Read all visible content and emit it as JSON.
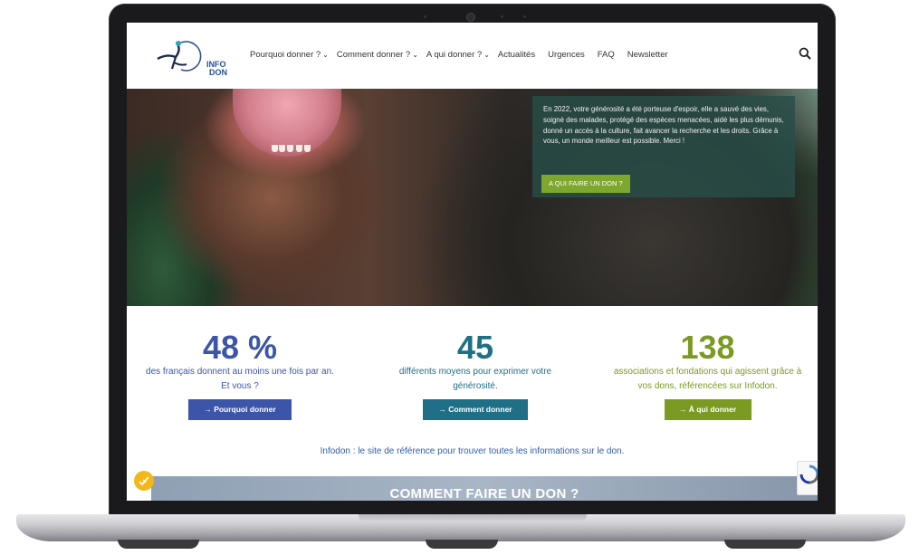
{
  "header": {
    "logo_line1": "INFO",
    "logo_line2": "DON",
    "nav": [
      {
        "label": "Pourquoi donner ?",
        "has_dropdown": true
      },
      {
        "label": "Comment donner ?",
        "has_dropdown": true
      },
      {
        "label": "A qui donner ?",
        "has_dropdown": true
      },
      {
        "label": "Actualités",
        "has_dropdown": false
      },
      {
        "label": "Urgences",
        "has_dropdown": false
      },
      {
        "label": "FAQ",
        "has_dropdown": false
      },
      {
        "label": "Newsletter",
        "has_dropdown": false
      }
    ],
    "search_icon": "search-icon"
  },
  "hero": {
    "text": "En 2022, votre générosité a été porteuse d'espoir, elle a sauvé des vies, soigné des malades, protégé des espèces menacées, aidé les plus démunis, donné un accès à la culture, fait avancer la recherche et les droits. Grâce à vous, un monde meilleur est possible. Merci !",
    "button": "A QUI FAIRE UN DON ?"
  },
  "stats": [
    {
      "number": "48 %",
      "line1": "des français donnent au moins une fois par an.",
      "line2": "Et vous ?",
      "button": "→ Pourquoi donner",
      "color": "#3c55a8"
    },
    {
      "number": "45",
      "line1": "différents moyens pour exprimer votre",
      "line2": "générosité.",
      "button": "→ Comment donner",
      "color": "#1f6f86"
    },
    {
      "number": "138",
      "line1": "associations et fondations qui agissent grâce à",
      "line2": "vos dons, référencées sur Infodon.",
      "button": "→ À qui donner",
      "color": "#7a9a22"
    }
  ],
  "tagline": "Infodon : le site de référence pour trouver toutes les informations sur le don.",
  "bottom": {
    "title": "COMMENT FAIRE UN DON ?"
  },
  "colors": {
    "accent_green": "#7ea72f",
    "brand_blue": "#2a4f9a",
    "hero_card": "#284e48"
  }
}
